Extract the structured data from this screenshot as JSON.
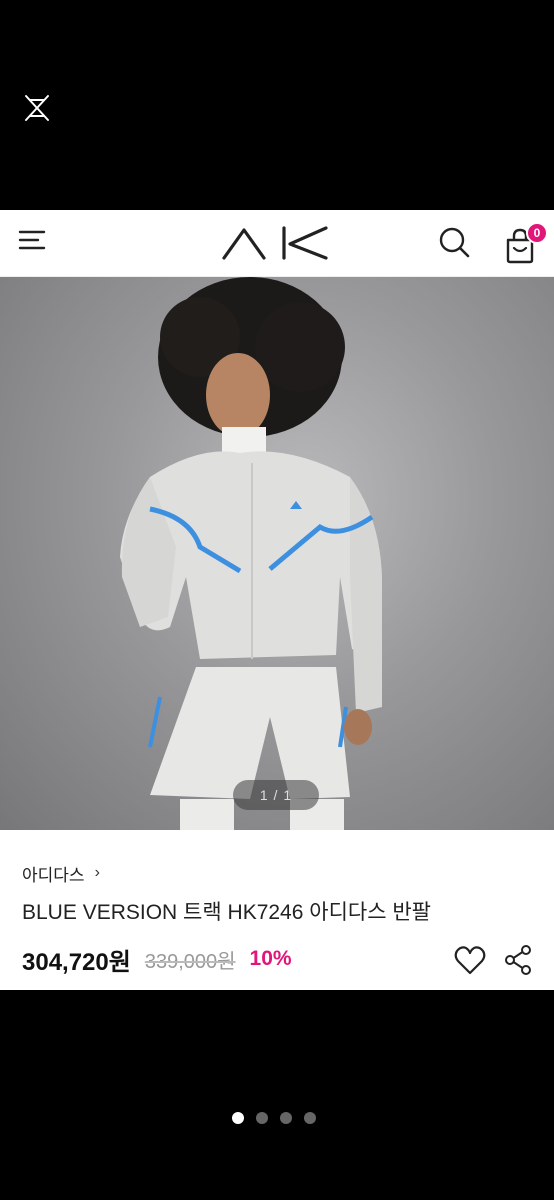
{
  "viewer": {
    "close_icon": "close-x-icon",
    "page_count": 4,
    "active_page": 1
  },
  "header": {
    "logo_text": "AK",
    "menu_icon": "hamburger-icon",
    "search_icon": "search-icon",
    "cart_icon": "shopping-bag-icon",
    "cart_count": "0",
    "badge_color": "#e2157a"
  },
  "product": {
    "image_counter": "1 / 1",
    "brand": "아디다스",
    "title": "BLUE VERSION 트랙 HK7246 아디다스 반팔",
    "sale_price": "304,720원",
    "original_price": "339,000원",
    "discount": "10%",
    "discount_color": "#e2157a"
  }
}
